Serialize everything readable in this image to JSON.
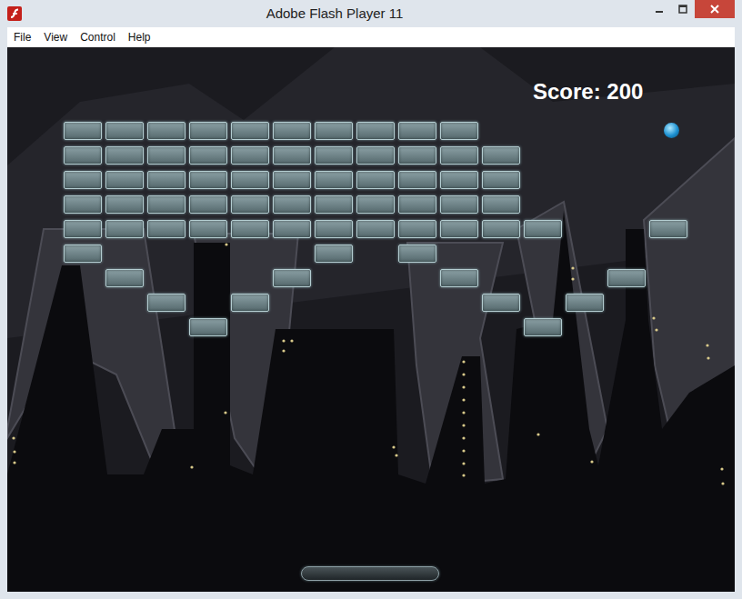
{
  "window": {
    "title": "Adobe Flash Player 11"
  },
  "menu": [
    "File",
    "View",
    "Control",
    "Help"
  ],
  "game": {
    "score": "Score: 200",
    "bricks": [
      [
        true,
        true,
        true,
        true,
        true,
        true,
        true,
        true,
        true,
        true,
        false,
        false,
        false,
        false,
        false
      ],
      [
        true,
        true,
        true,
        true,
        true,
        true,
        true,
        true,
        true,
        true,
        true,
        false,
        false,
        false,
        false
      ],
      [
        true,
        true,
        true,
        true,
        true,
        true,
        true,
        true,
        true,
        true,
        true,
        false,
        false,
        false,
        false
      ],
      [
        true,
        true,
        true,
        true,
        true,
        true,
        true,
        true,
        true,
        true,
        true,
        false,
        false,
        false,
        false
      ],
      [
        true,
        true,
        true,
        true,
        true,
        true,
        true,
        true,
        true,
        true,
        true,
        true,
        false,
        false,
        true
      ],
      [
        true,
        false,
        false,
        false,
        false,
        false,
        true,
        false,
        true,
        false,
        false,
        false,
        false,
        false,
        false
      ],
      [
        false,
        true,
        false,
        false,
        false,
        true,
        false,
        false,
        false,
        true,
        false,
        false,
        false,
        true,
        false
      ],
      [
        false,
        false,
        true,
        false,
        true,
        false,
        false,
        false,
        false,
        false,
        true,
        false,
        true,
        false,
        false
      ],
      [
        false,
        false,
        false,
        true,
        false,
        false,
        false,
        false,
        false,
        false,
        false,
        true,
        false,
        false,
        false
      ]
    ]
  }
}
